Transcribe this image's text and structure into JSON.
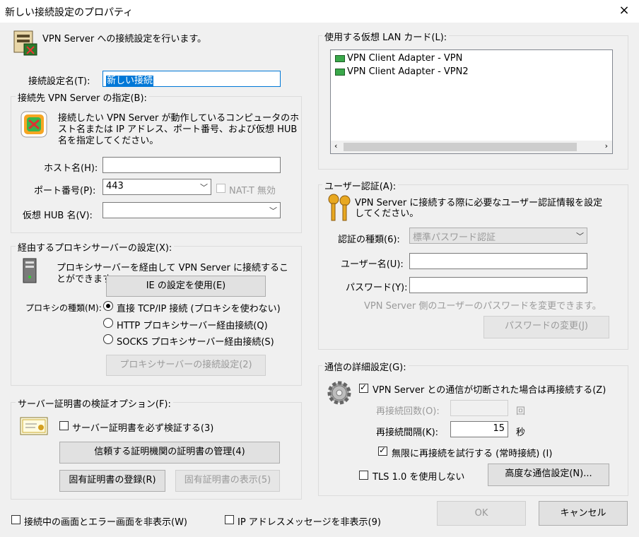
{
  "window": {
    "title": "新しい接続設定のプロパティ",
    "close": "×"
  },
  "header": {
    "text": "VPN Server への接続設定を行います。"
  },
  "conn_name": {
    "label": "接続設定名(T):",
    "value": "新しい接続"
  },
  "server_group": {
    "title": "接続先 VPN Server の指定(B):",
    "desc": [
      "接続したい VPN Server が動作しているコンピュータのホ",
      "スト名または IP アドレス、ポート番号、および仮想 HUB",
      "名を指定してください。"
    ],
    "host_label": "ホスト名(H):",
    "host_value": "",
    "port_label": "ポート番号(P):",
    "port_value": "443",
    "natt_label": "NAT-T 無効",
    "hub_label": "仮想 HUB 名(V):",
    "hub_value": ""
  },
  "proxy_group": {
    "title": "経由するプロキシサーバーの設定(X):",
    "desc": [
      "プロキシサーバーを経由して VPN Server に接続するこ",
      "とができます"
    ],
    "ie_button": "IE の設定を使用(E)",
    "type_label": "プロキシの種類(M):",
    "options": [
      "直接 TCP/IP 接続 (プロキシを使わない)",
      "HTTP プロキシサーバー経由接続(Q)",
      "SOCKS プロキシサーバー経由接続(S)"
    ],
    "settings_button": "プロキシサーバーの接続設定(2)"
  },
  "cert_group": {
    "title": "サーバー証明書の検証オプション(F):",
    "verify_label": "サーバー証明書を必ず検証する(3)",
    "manage_button": "信頼する証明機関の証明書の管理(4)",
    "register_button": "固有証明書の登録(R)",
    "show_button": "固有証明書の表示(5)"
  },
  "bottom": {
    "hide_screen": "接続中の画面とエラー画面を非表示(W)",
    "hide_ip": "IP アドレスメッセージを非表示(9)"
  },
  "lan_group": {
    "title": "使用する仮想 LAN カード(L):",
    "items": [
      "VPN Client Adapter - VPN",
      "VPN Client Adapter - VPN2"
    ]
  },
  "auth_group": {
    "title": "ユーザー認証(A):",
    "desc": [
      "VPN Server に接続する際に必要なユーザー認証情報を設定",
      "してください。"
    ],
    "type_label": "認証の種類(6):",
    "type_value": "標準パスワード認証",
    "user_label": "ユーザー名(U):",
    "user_value": "",
    "pass_label": "パスワード(Y):",
    "pass_value": "",
    "note": "VPN Server 側のユーザーのパスワードを変更できます。",
    "change_button": "パスワードの変更(J)"
  },
  "adv_group": {
    "title": "通信の詳細設定(G):",
    "reconnect_label": "VPN Server との通信が切断された場合は再接続する(Z)",
    "count_label": "再接続回数(O):",
    "count_value": "",
    "count_unit": "回",
    "interval_label": "再接続間隔(K):",
    "interval_value": "15",
    "interval_unit": "秒",
    "infinite_label": "無限に再接続を試行する (常時接続) (I)",
    "tls_label": "TLS 1.0 を使用しない",
    "advanced_button": "高度な通信設定(N)..."
  },
  "footer": {
    "ok": "OK",
    "cancel": "キャンセル"
  },
  "icons": {
    "server": "server-monitor-icon",
    "rainbow": "connection-icon",
    "pc": "computer-tower-icon",
    "cert": "certificate-icon",
    "keys": "keys-icon",
    "gear": "gear-icon"
  }
}
